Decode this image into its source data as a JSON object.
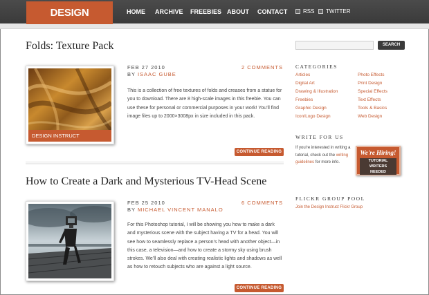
{
  "header": {
    "logo": "DESIGN INSTRUCT",
    "nav": [
      {
        "label": "HOME"
      },
      {
        "label": "ARCHIVE"
      },
      {
        "label": "FREEBIES"
      },
      {
        "label": "ABOUT"
      },
      {
        "label": "CONTACT"
      }
    ],
    "feeds": [
      {
        "label": "RSS",
        "icon": "rss-icon"
      },
      {
        "label": "TWITTER",
        "icon": "twitter-icon"
      }
    ]
  },
  "posts": [
    {
      "title": "Folds: Texture Pack",
      "date": "FEB 27 2010",
      "by": "BY",
      "author": "ISAAC GUBE",
      "comments": "2 COMMENTS",
      "excerpt": "This is a collection of free textures of folds and creases from a statue for you to download. There are 8 high-scale images in this freebie. You can use these for personal or commercial purposes in your work! You’ll find image files up to 2000×3008px in size included in this pack.",
      "thumb_caption": "DESIGN INSTRUCT",
      "continue": "CONTINUE READING"
    },
    {
      "title": "How to Create a Dark and Mysterious TV-Head Scene",
      "date": "FEB 25 2010",
      "by": "BY",
      "author": "MICHAEL VINCENT MANALO",
      "comments": "6 COMMENTS",
      "excerpt": "For this Photoshop tutorial, I will be showing you how to make a dark and mysterious scene with the subject having a TV for a head. You will see how to seamlessly replace a person’s head with another object—in this case, a television—and how to create a stormy sky using brush strokes. We’ll also deal with creating realistic lights and shadows as well as how to retouch subjects who are against a light source.",
      "continue": "CONTINUE READING"
    }
  ],
  "sidebar": {
    "search_button": "SEARCH",
    "categories_title": "CATEGORIES",
    "categories_left": [
      "Articles",
      "Digital Art",
      "Drawing & Illustration",
      "Freebies",
      "Graphic Design",
      "Icon/Logo Design"
    ],
    "categories_right": [
      "Photo Effects",
      "Print Design",
      "Special Effects",
      "Text Effects",
      "Tools & Basics",
      "Web Design"
    ],
    "write_title": "WRITE FOR US",
    "write_text_1": "If you're interested in writing a tutorial, check out the",
    "write_link": "writing guidelines",
    "write_text_2": "for more info.",
    "hiring_title": "We're Hiring!",
    "hiring_sub_1": "TUTORIAL WRITERS",
    "hiring_sub_2": "NEEDED",
    "flickr_title": "FLICKR GROUP POOL",
    "flickr_link": "Join the Design Instruct Flickr Group"
  },
  "colors": {
    "accent": "#c65a30",
    "header": "#3f3f3f"
  }
}
